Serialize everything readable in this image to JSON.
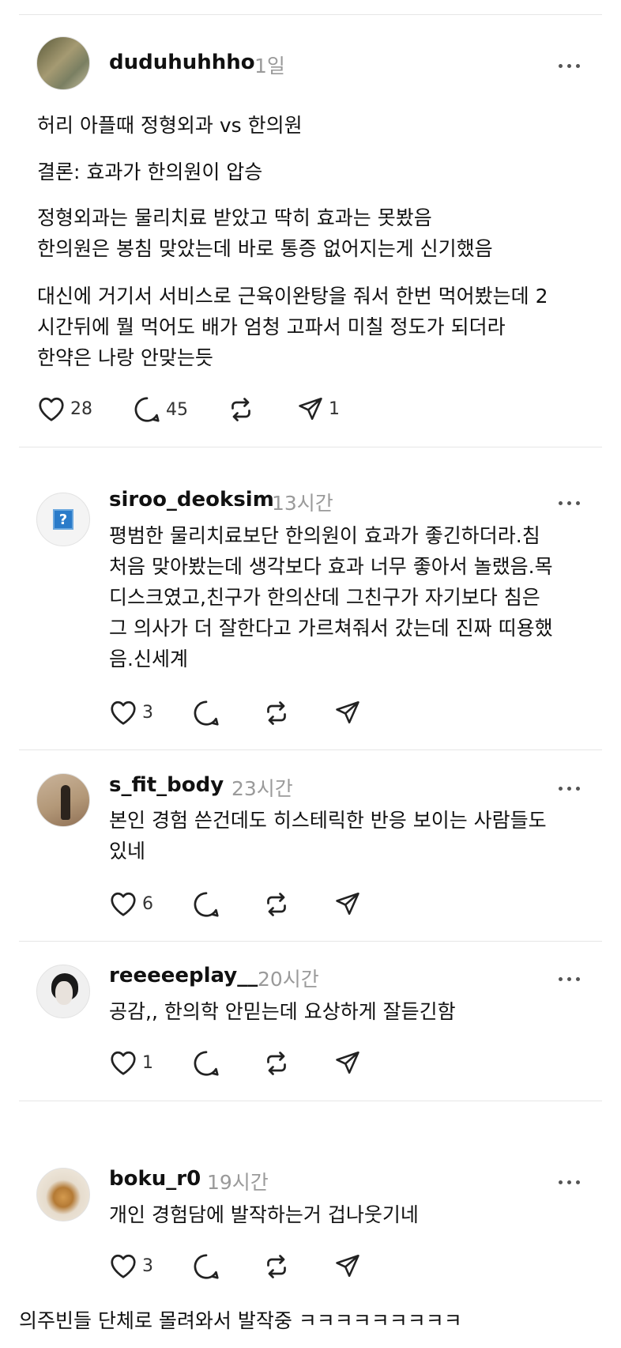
{
  "post": {
    "username": "duduhuhhho",
    "time": "1일",
    "lines": [
      "허리 아플때 정형외과 vs 한의원",
      "결론: 효과가 한의원이 압승",
      "정형외과는 물리치료 받았고 딱히 효과는 못봤음",
      "한의원은 봉침 맞았는데 바로 통증 없어지는게 신기했음",
      "대신에 거기서 서비스로 근육이완탕을 줘서 한번 먹어봤는데 2",
      "시간뒤에 뭘 먹어도 배가 엄청 고파서 미칠 정도가 되더라",
      "한약은 나랑 안맞는듯"
    ],
    "likes": "28",
    "comments": "45",
    "shares": "1"
  },
  "replies": [
    {
      "username": "siroo_deoksim",
      "time": "13시간",
      "avatar_icon": "?",
      "lines": [
        "평범한 물리치료보단 한의원이 효과가 좋긴하더라.침",
        "처음 맞아봤는데 생각보다 효과 너무 좋아서 놀랬음.목",
        "디스크였고,친구가 한의산데 그친구가 자기보다 침은",
        "그 의사가 더 잘한다고 가르쳐줘서 갔는데 진짜 띠용했",
        "음.신세계"
      ],
      "likes": "3"
    },
    {
      "username": "s_fit_body",
      "time": "23시간",
      "lines": [
        "본인 경험 쓴건데도 히스테릭한 반응 보이는 사람들도",
        "있네"
      ],
      "likes": "6"
    },
    {
      "username": "reeeeeplay__",
      "time": "20시간",
      "lines": [
        "공감,, 한의학 안믿는데 요상하게 잘듣긴함"
      ],
      "likes": "1"
    },
    {
      "username": "boku_r0",
      "time": "19시간",
      "lines": [
        "개인 경험담에 발작하는거 겁나웃기네"
      ],
      "likes": "3"
    }
  ],
  "caption": "의주빈들 단체로 몰려와서 발작중 ㅋㅋㅋㅋㅋㅋㅋㅋㅋ",
  "icons": [
    "heart-icon",
    "comment-icon",
    "repost-icon",
    "send-icon",
    "more-icon"
  ],
  "colors": {
    "text": "#111111",
    "muted": "#9a9a9a",
    "divider": "#e6e6e6"
  }
}
